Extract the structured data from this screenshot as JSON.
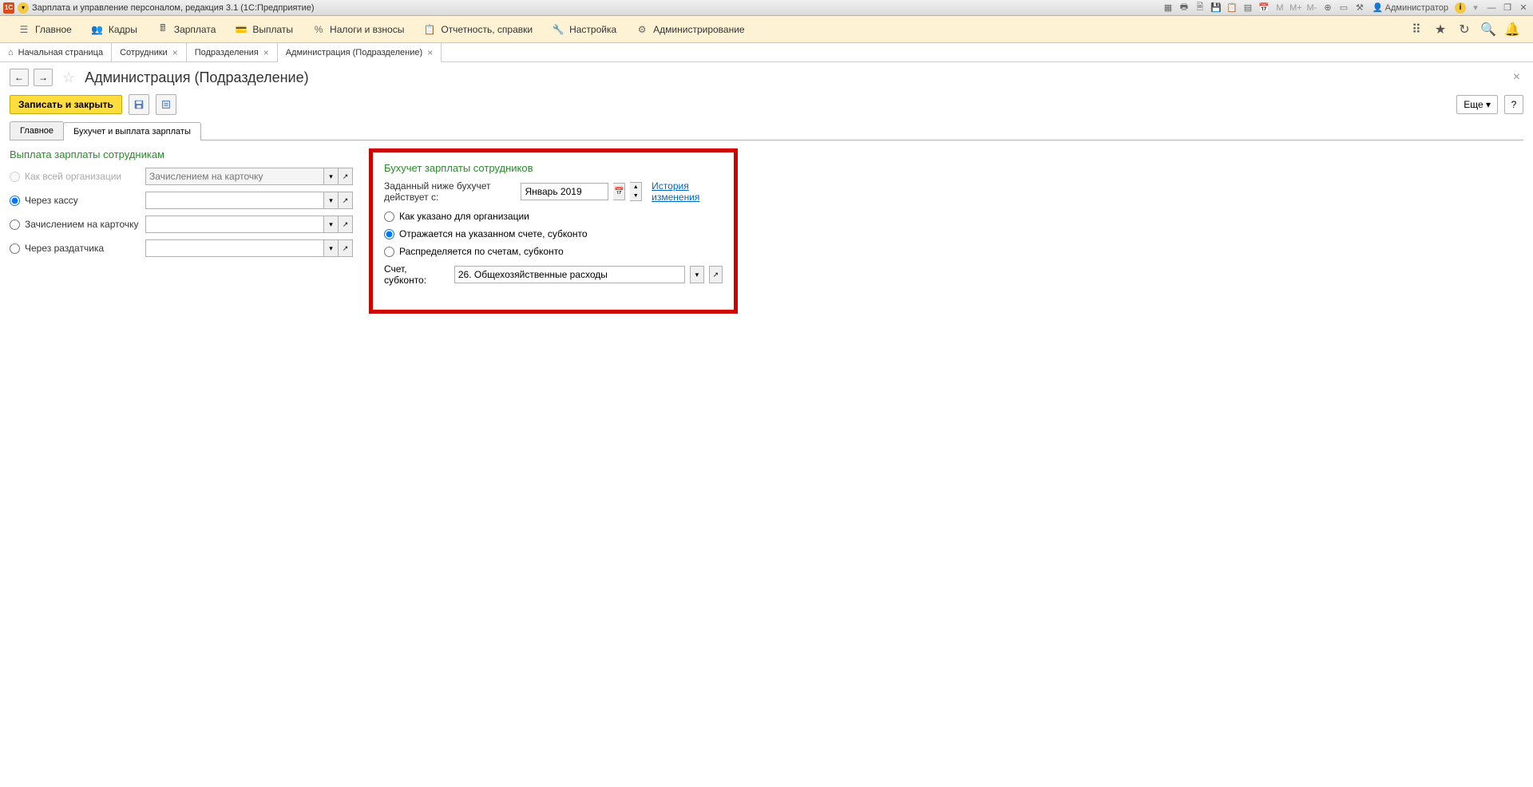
{
  "titlebar": {
    "logo": "1C",
    "title": "Зарплата и управление персоналом, редакция 3.1  (1С:Предприятие)",
    "user_label": "Администратор",
    "info": "i"
  },
  "mainmenu": {
    "items": [
      {
        "label": "Главное",
        "icon": "menu"
      },
      {
        "label": "Кадры",
        "icon": "people"
      },
      {
        "label": "Зарплата",
        "icon": "calc"
      },
      {
        "label": "Выплаты",
        "icon": "wallet"
      },
      {
        "label": "Налоги и взносы",
        "icon": "percent"
      },
      {
        "label": "Отчетность, справки",
        "icon": "clipboard"
      },
      {
        "label": "Настройка",
        "icon": "wrench"
      },
      {
        "label": "Администрирование",
        "icon": "gear"
      }
    ]
  },
  "tabs": [
    {
      "label": "Начальная страница",
      "closable": false
    },
    {
      "label": "Сотрудники",
      "closable": true
    },
    {
      "label": "Подразделения",
      "closable": true
    },
    {
      "label": "Администрация (Подразделение)",
      "closable": true,
      "active": true
    }
  ],
  "page": {
    "title": "Администрация (Подразделение)"
  },
  "toolbar": {
    "save_close": "Записать и закрыть",
    "more": "Еще",
    "help": "?"
  },
  "inner_tabs": [
    {
      "label": "Главное"
    },
    {
      "label": "Бухучет и выплата зарплаты",
      "active": true
    }
  ],
  "salary_payment": {
    "title": "Выплата зарплаты сотрудникам",
    "options": [
      {
        "label": "Как всей организации",
        "placeholder": "Зачислением на карточку"
      },
      {
        "label": "Через кассу"
      },
      {
        "label": "Зачислением на карточку"
      },
      {
        "label": "Через раздатчика"
      }
    ]
  },
  "accounting": {
    "title": "Бухучет зарплаты сотрудников",
    "effective_label": "Заданный ниже бухучет действует с:",
    "effective_date": "Январь 2019",
    "history_link": "История изменения",
    "options": [
      "Как указано для организации",
      "Отражается на указанном счете, субконто",
      "Распределяется по счетам, субконто"
    ],
    "account_label": "Счет, субконто:",
    "account_value": "26. Общехозяйственные расходы"
  }
}
